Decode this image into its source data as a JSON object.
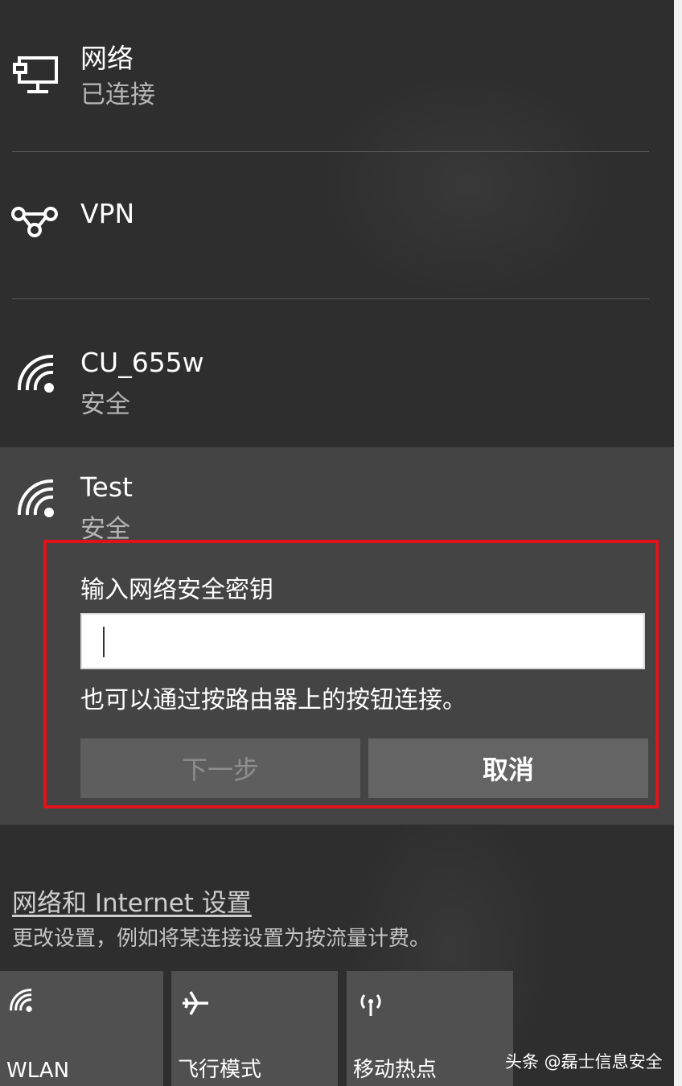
{
  "networks": [
    {
      "name": "网络",
      "status": "已连接",
      "icon": "ethernet-icon"
    },
    {
      "name": "VPN",
      "icon": "vpn-icon"
    },
    {
      "name": "CU_655w",
      "status": "安全",
      "icon": "wifi-icon"
    },
    {
      "name": "Test",
      "status": "安全",
      "icon": "wifi-icon"
    }
  ],
  "connect_form": {
    "label": "输入网络安全密钥",
    "value": "",
    "hint": "也可以通过按路由器上的按钮连接。",
    "next_label": "下一步",
    "cancel_label": "取消"
  },
  "settings": {
    "link": "网络和 Internet 设置",
    "description": "更改设置，例如将某连接设置为按流量计费。"
  },
  "quick_actions": [
    {
      "label": "WLAN",
      "icon": "wifi-icon"
    },
    {
      "label": "飞行模式",
      "icon": "airplane-icon"
    },
    {
      "label": "移动热点",
      "icon": "hotspot-icon"
    }
  ],
  "watermark": "头条 @磊士信息安全",
  "colors": {
    "highlight": "#e0121a",
    "panel": "#2e2e2e",
    "expanded": "#444444"
  }
}
